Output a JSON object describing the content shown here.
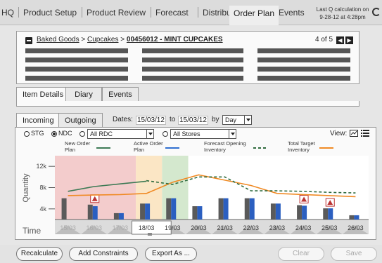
{
  "nav": {
    "items": [
      "HQ",
      "Product Setup",
      "Product Review",
      "Forecast",
      "Distribution",
      "Order Plan",
      "Events"
    ],
    "active": "Order Plan",
    "last_calc_line1": "Last Q calculation on",
    "last_calc_line2": "9-28-12 at 4:28pm"
  },
  "header": {
    "crumb_1": "Baked Goods",
    "crumb_sep1": " > ",
    "crumb_2": "Cupcakes",
    "crumb_sep2": " > ",
    "crumb_3": "00456012 - MINT CUPCAKES",
    "pager": "4 of 5"
  },
  "detail_tabs": [
    "Item Details",
    "Diary",
    "Events"
  ],
  "flow_tabs": [
    "Incoming",
    "Outgoing"
  ],
  "dates": {
    "label": "Dates:",
    "from": "15/03/12",
    "to_label": "to",
    "to": "15/03/12",
    "by_label": "by",
    "period": "Day"
  },
  "filters": {
    "stg": "STG",
    "ndc": "NDC",
    "rdc": "All RDC",
    "stores": "All Stores",
    "view_label": "View:"
  },
  "colors": {
    "new_order": "#3d7a55",
    "active_order": "#2f6fd0",
    "forecast": "#2f6b3e",
    "target": "#f08a24",
    "bar_grey": "#5a5a5a",
    "bar_blue": "#2b5fc0"
  },
  "chart_data": {
    "type": "bar",
    "ylabel": "Quantity",
    "xlabel": "Time",
    "yticks": [
      "12k",
      "8k",
      "4k"
    ],
    "ylim": [
      2000,
      14000
    ],
    "categories": [
      "15/03",
      "16/03",
      "17/03",
      "18/03",
      "19/03",
      "20/03",
      "21/03",
      "22/03",
      "23/03",
      "24/03",
      "25/03",
      "26/03"
    ],
    "legend": [
      {
        "name": "New Order Plan",
        "style": "solid"
      },
      {
        "name": "Active Order Plan",
        "style": "solid"
      },
      {
        "name": "Forecast Opening Inventory",
        "style": "dashed"
      },
      {
        "name": "Total Target Inventory",
        "style": "solid"
      }
    ],
    "bars_grey": [
      6000,
      4800,
      3200,
      5000,
      6000,
      4500,
      6000,
      6000,
      5000,
      4700,
      4100,
      2800
    ],
    "bars_blue": [
      null,
      4500,
      3200,
      5000,
      6000,
      4500,
      6000,
      6000,
      5000,
      4600,
      4100,
      2800
    ],
    "alerts": [
      1,
      9,
      10
    ],
    "new_order_line": [
      7300,
      8200,
      8700,
      9200,
      null,
      null,
      null,
      null,
      null,
      null,
      null,
      null
    ],
    "forecast_line": [
      null,
      null,
      null,
      9300,
      8600,
      10000,
      10000,
      7400,
      7400,
      7300,
      7100,
      7000
    ],
    "target_line": [
      6500,
      6600,
      6700,
      6900,
      9000,
      10400,
      9400,
      8400,
      6900,
      6700,
      6500,
      6300
    ]
  },
  "footer": {
    "recalculate": "Recalculate",
    "constraints": "Add Constraints",
    "export": "Export As ...",
    "clear": "Clear",
    "save": "Save"
  }
}
